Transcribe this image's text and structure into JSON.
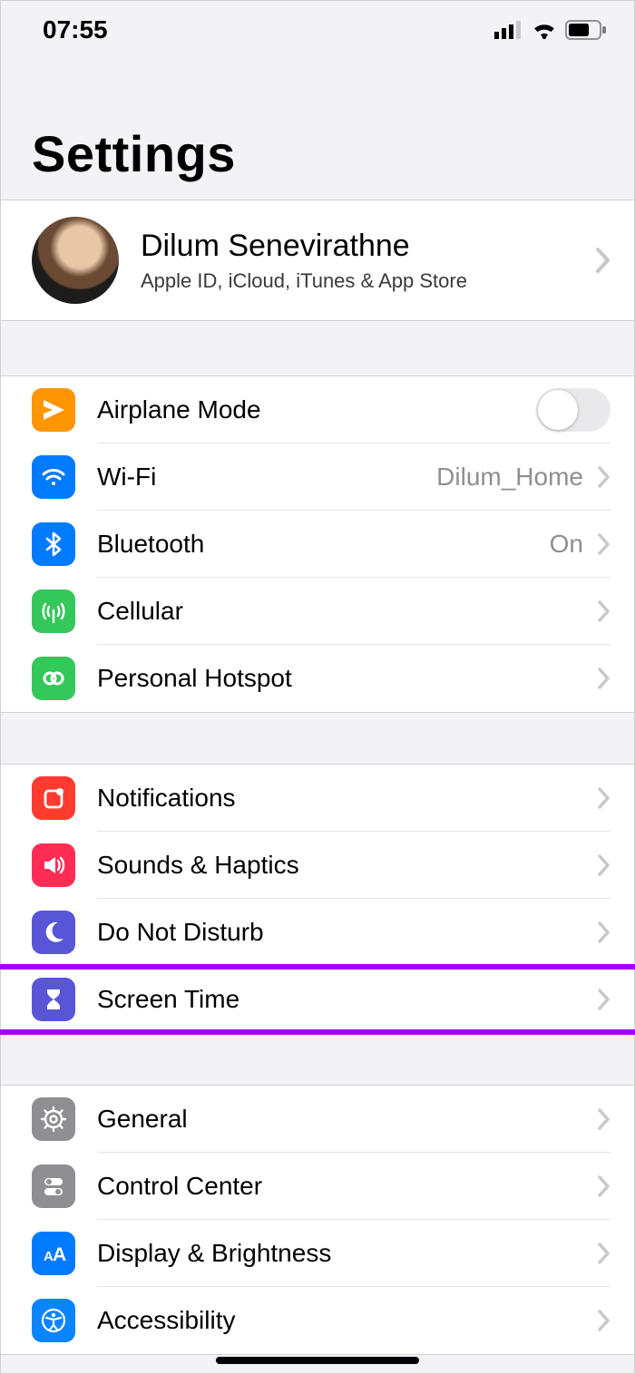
{
  "status": {
    "time": "07:55"
  },
  "title": "Settings",
  "profile": {
    "name": "Dilum Senevirathne",
    "subtitle": "Apple ID, iCloud, iTunes & App Store"
  },
  "groups": [
    {
      "id": "connectivity",
      "rows": [
        {
          "id": "airplane",
          "label": "Airplane Mode",
          "icon": "airplane",
          "color": "c-orange",
          "control": "toggle",
          "toggle_on": false
        },
        {
          "id": "wifi",
          "label": "Wi-Fi",
          "icon": "wifi",
          "color": "c-blue",
          "control": "chevron",
          "value": "Dilum_Home"
        },
        {
          "id": "bluetooth",
          "label": "Bluetooth",
          "icon": "bluetooth",
          "color": "c-blue",
          "control": "chevron",
          "value": "On"
        },
        {
          "id": "cellular",
          "label": "Cellular",
          "icon": "cellular",
          "color": "c-green",
          "control": "chevron"
        },
        {
          "id": "hotspot",
          "label": "Personal Hotspot",
          "icon": "hotspot",
          "color": "c-green",
          "control": "chevron"
        }
      ]
    },
    {
      "id": "alerts",
      "rows": [
        {
          "id": "notifications",
          "label": "Notifications",
          "icon": "notifications",
          "color": "c-red",
          "control": "chevron"
        },
        {
          "id": "sounds",
          "label": "Sounds & Haptics",
          "icon": "sounds",
          "color": "c-pink",
          "control": "chevron"
        },
        {
          "id": "dnd",
          "label": "Do Not Disturb",
          "icon": "moon",
          "color": "c-indigo",
          "control": "chevron"
        },
        {
          "id": "screentime",
          "label": "Screen Time",
          "icon": "hourglass",
          "color": "c-indigo",
          "control": "chevron",
          "highlighted": true
        }
      ]
    },
    {
      "id": "system",
      "rows": [
        {
          "id": "general",
          "label": "General",
          "icon": "gear",
          "color": "c-gray",
          "control": "chevron"
        },
        {
          "id": "controlcenter",
          "label": "Control Center",
          "icon": "switches",
          "color": "c-gray",
          "control": "chevron"
        },
        {
          "id": "display",
          "label": "Display & Brightness",
          "icon": "textsize",
          "color": "c-blue",
          "control": "chevron"
        },
        {
          "id": "accessibility",
          "label": "Accessibility",
          "icon": "accessibility",
          "color": "c-blue2",
          "control": "chevron"
        }
      ]
    }
  ],
  "highlight_color": "#a100ff"
}
